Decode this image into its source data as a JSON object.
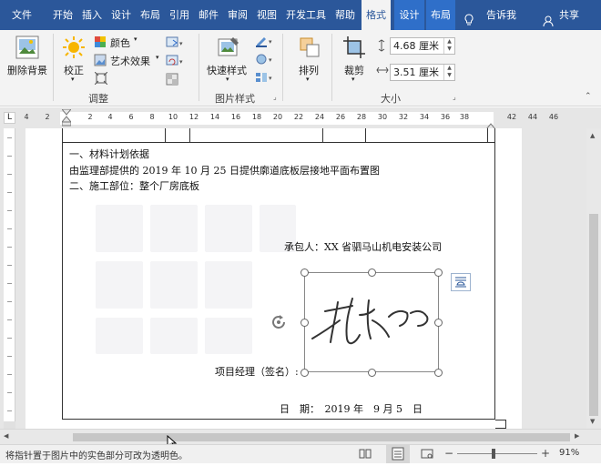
{
  "tabs": [
    {
      "label": "文件"
    },
    {
      "label": "开始"
    },
    {
      "label": "插入"
    },
    {
      "label": "设计"
    },
    {
      "label": "布局"
    },
    {
      "label": "引用"
    },
    {
      "label": "邮件"
    },
    {
      "label": "审阅"
    },
    {
      "label": "视图"
    },
    {
      "label": "开发工具"
    },
    {
      "label": "帮助"
    },
    {
      "label": "格式"
    },
    {
      "label": "设计"
    },
    {
      "label": "布局"
    }
  ],
  "tell_me": "告诉我",
  "share": "共享",
  "ribbon": {
    "remove_bg": "删除背景",
    "corrections": "校正",
    "color": "颜色",
    "artistic": "艺术效果",
    "adjust_group": "调整",
    "quick_styles": "快速样式",
    "picture_styles_group": "图片样式",
    "arrange": "排列",
    "crop": "裁剪",
    "height": "4.68 厘米",
    "width": "3.51 厘米",
    "size_group": "大小"
  },
  "ruler_numbers": [
    "4",
    "2",
    "2",
    "4",
    "6",
    "8",
    "10",
    "12",
    "14",
    "16",
    "18",
    "20",
    "22",
    "24",
    "26",
    "28",
    "30",
    "32",
    "34",
    "36",
    "38",
    "42",
    "44",
    "46"
  ],
  "document": {
    "line1": "一、材料计划依据",
    "line2": "由监理部提供的 2019 年 10 月 25 日提供廓道底板层接地平面布置图",
    "line3": "二、施工部位：整个厂房底板",
    "contractor": "承包人：XX 省驷马山机电安装公司",
    "manager": "项目经理（签名）:",
    "date": "日　期：　2019 年　9 月 5　日"
  },
  "status": {
    "message": "将指针置于图片中的实色部分可改为透明色。",
    "zoom": "91%"
  },
  "colors": {
    "tabbar": "#2b579a",
    "ribbon": "#f3f3f3",
    "accent": "#2b579a"
  }
}
